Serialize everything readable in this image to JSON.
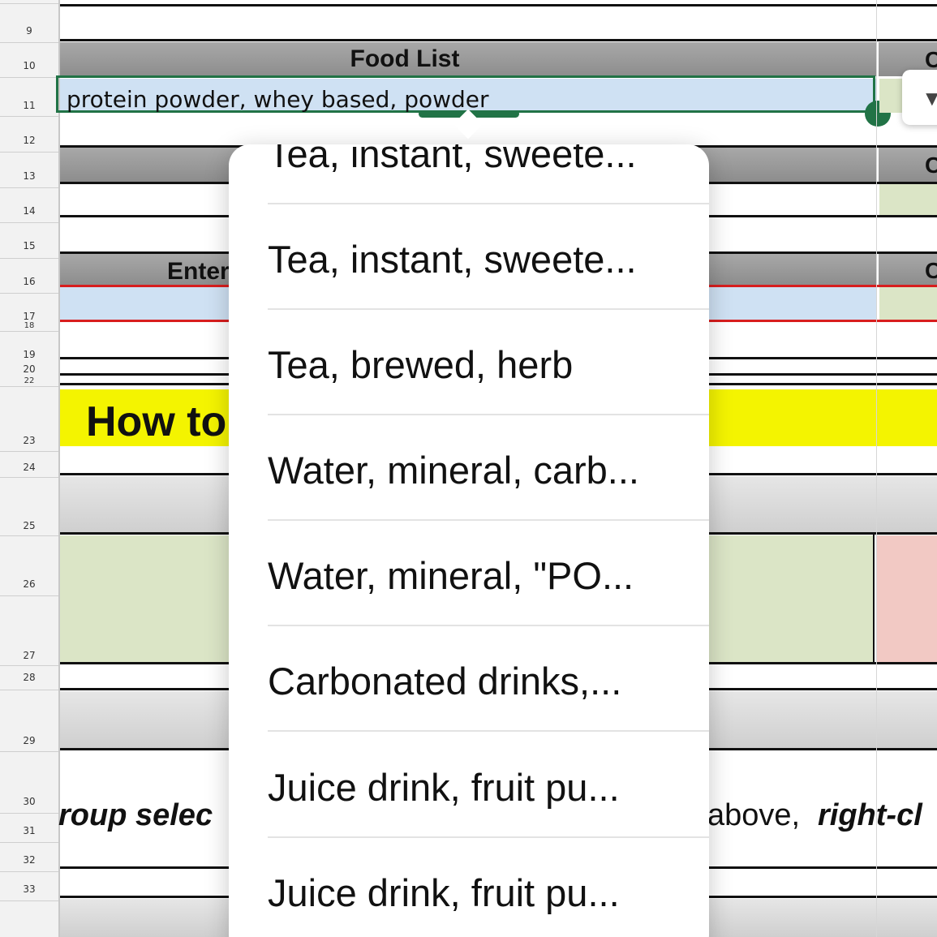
{
  "row_numbers": [
    "9",
    "10",
    "11",
    "12",
    "13",
    "14",
    "15",
    "16",
    "17",
    "18",
    "19",
    "20",
    "22",
    "23",
    "24",
    "25",
    "26",
    "27",
    "28",
    "29",
    "30",
    "31",
    "32",
    "33"
  ],
  "food_list_header": "Food List",
  "selected_cell_value": "protein powder, whey based, powder",
  "enter_label": "Enter",
  "how_to_label": "How to",
  "group_select_text": "roup selec",
  "above_text": "above,",
  "right_click_text": "right-cl",
  "right_col_letter": "C",
  "dropdown_items": [
    "Tea, instant, sweete...",
    "Tea, instant, sweete...",
    "Tea, brewed, herb",
    "Water, mineral, carb...",
    "Water, mineral, \"PO...",
    "Carbonated drinks,...",
    "Juice drink, fruit pu...",
    "Juice drink, fruit pu..."
  ],
  "colors": {
    "header_gray": "#9a9a9a",
    "selected_cell_bg": "#cfe1f3",
    "selection_border": "#217346",
    "highlight_yellow": "#f4f400",
    "input_green": "#dbe5c6",
    "alert_pink": "#f2c9c4",
    "red_border": "#d81e1e"
  }
}
